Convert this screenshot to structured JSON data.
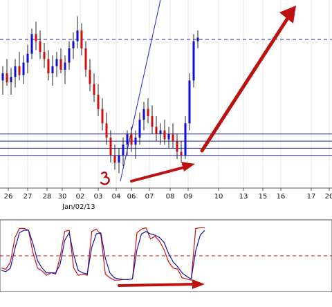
{
  "chart_data": [
    {
      "type": "candlestick",
      "title": "",
      "xlabel": "",
      "ylabel": "",
      "x_tick_labels": [
        "26",
        "27",
        "28",
        "30",
        "02",
        "03",
        "04",
        "06",
        "07",
        "08",
        "09",
        "10",
        "13",
        "15",
        "16",
        "17",
        "20"
      ],
      "date_label": "Jan/02/13",
      "up_color": "#1010cc",
      "down_color": "#cc1010",
      "ylim": [
        0,
        100
      ],
      "resistance_dashed_level": 81,
      "support_levels": [
        28,
        24,
        20,
        16
      ],
      "candles": [
        {
          "o": 58,
          "h": 66,
          "l": 50,
          "c": 62
        },
        {
          "o": 62,
          "h": 70,
          "l": 55,
          "c": 57
        },
        {
          "o": 57,
          "h": 65,
          "l": 50,
          "c": 60
        },
        {
          "o": 60,
          "h": 70,
          "l": 54,
          "c": 66
        },
        {
          "o": 66,
          "h": 74,
          "l": 58,
          "c": 61
        },
        {
          "o": 61,
          "h": 72,
          "l": 56,
          "c": 68
        },
        {
          "o": 68,
          "h": 78,
          "l": 62,
          "c": 73
        },
        {
          "o": 73,
          "h": 87,
          "l": 70,
          "c": 84
        },
        {
          "o": 84,
          "h": 91,
          "l": 75,
          "c": 80
        },
        {
          "o": 80,
          "h": 86,
          "l": 70,
          "c": 74
        },
        {
          "o": 74,
          "h": 79,
          "l": 65,
          "c": 70
        },
        {
          "o": 70,
          "h": 75,
          "l": 58,
          "c": 62
        },
        {
          "o": 62,
          "h": 72,
          "l": 55,
          "c": 66
        },
        {
          "o": 66,
          "h": 74,
          "l": 60,
          "c": 70
        },
        {
          "o": 70,
          "h": 76,
          "l": 62,
          "c": 64
        },
        {
          "o": 64,
          "h": 72,
          "l": 56,
          "c": 68
        },
        {
          "o": 68,
          "h": 80,
          "l": 64,
          "c": 76
        },
        {
          "o": 76,
          "h": 85,
          "l": 70,
          "c": 80
        },
        {
          "o": 80,
          "h": 94,
          "l": 76,
          "c": 86
        },
        {
          "o": 86,
          "h": 90,
          "l": 72,
          "c": 76
        },
        {
          "o": 76,
          "h": 80,
          "l": 60,
          "c": 64
        },
        {
          "o": 64,
          "h": 70,
          "l": 52,
          "c": 56
        },
        {
          "o": 56,
          "h": 62,
          "l": 46,
          "c": 50
        },
        {
          "o": 50,
          "h": 56,
          "l": 38,
          "c": 42
        },
        {
          "o": 42,
          "h": 48,
          "l": 30,
          "c": 34
        },
        {
          "o": 34,
          "h": 40,
          "l": 22,
          "c": 26
        },
        {
          "o": 26,
          "h": 30,
          "l": 12,
          "c": 16
        },
        {
          "o": 16,
          "h": 22,
          "l": 8,
          "c": 12
        },
        {
          "o": 12,
          "h": 20,
          "l": 6,
          "c": 16
        },
        {
          "o": 16,
          "h": 26,
          "l": 10,
          "c": 22
        },
        {
          "o": 22,
          "h": 30,
          "l": 16,
          "c": 28
        },
        {
          "o": 28,
          "h": 32,
          "l": 18,
          "c": 22
        },
        {
          "o": 22,
          "h": 30,
          "l": 14,
          "c": 26
        },
        {
          "o": 26,
          "h": 40,
          "l": 22,
          "c": 36
        },
        {
          "o": 36,
          "h": 46,
          "l": 30,
          "c": 42
        },
        {
          "o": 42,
          "h": 48,
          "l": 34,
          "c": 38
        },
        {
          "o": 38,
          "h": 44,
          "l": 28,
          "c": 32
        },
        {
          "o": 32,
          "h": 38,
          "l": 24,
          "c": 28
        },
        {
          "o": 28,
          "h": 34,
          "l": 22,
          "c": 30
        },
        {
          "o": 30,
          "h": 36,
          "l": 22,
          "c": 25
        },
        {
          "o": 25,
          "h": 32,
          "l": 20,
          "c": 28
        },
        {
          "o": 28,
          "h": 34,
          "l": 20,
          "c": 24
        },
        {
          "o": 24,
          "h": 28,
          "l": 14,
          "c": 18
        },
        {
          "o": 18,
          "h": 24,
          "l": 12,
          "c": 16
        },
        {
          "o": 16,
          "h": 38,
          "l": 14,
          "c": 34
        },
        {
          "o": 34,
          "h": 62,
          "l": 30,
          "c": 58
        },
        {
          "o": 58,
          "h": 84,
          "l": 54,
          "c": 80
        },
        {
          "o": 80,
          "h": 86,
          "l": 76,
          "c": 82
        }
      ]
    },
    {
      "type": "line",
      "title": "",
      "ylim": [
        0,
        100
      ],
      "midline_level": 50,
      "series": [
        {
          "color": "#cc1010",
          "values": [
            30,
            28,
            40,
            80,
            95,
            95,
            92,
            55,
            30,
            25,
            18,
            22,
            20,
            48,
            90,
            92,
            30,
            18,
            20,
            18,
            90,
            94,
            85,
            20,
            14,
            10,
            10,
            11,
            11,
            12,
            88,
            94,
            96,
            78,
            82,
            74,
            60,
            40,
            30,
            28,
            14,
            12,
            10,
            95,
            96,
            96
          ]
        },
        {
          "color": "#1010aa",
          "values": [
            26,
            24,
            30,
            62,
            88,
            92,
            92,
            70,
            42,
            30,
            22,
            22,
            22,
            36,
            75,
            88,
            52,
            26,
            22,
            20,
            64,
            86,
            88,
            46,
            22,
            14,
            12,
            11,
            11,
            12,
            60,
            86,
            90,
            86,
            84,
            80,
            72,
            54,
            40,
            32,
            22,
            16,
            12,
            58,
            84,
            92
          ]
        }
      ]
    }
  ]
}
